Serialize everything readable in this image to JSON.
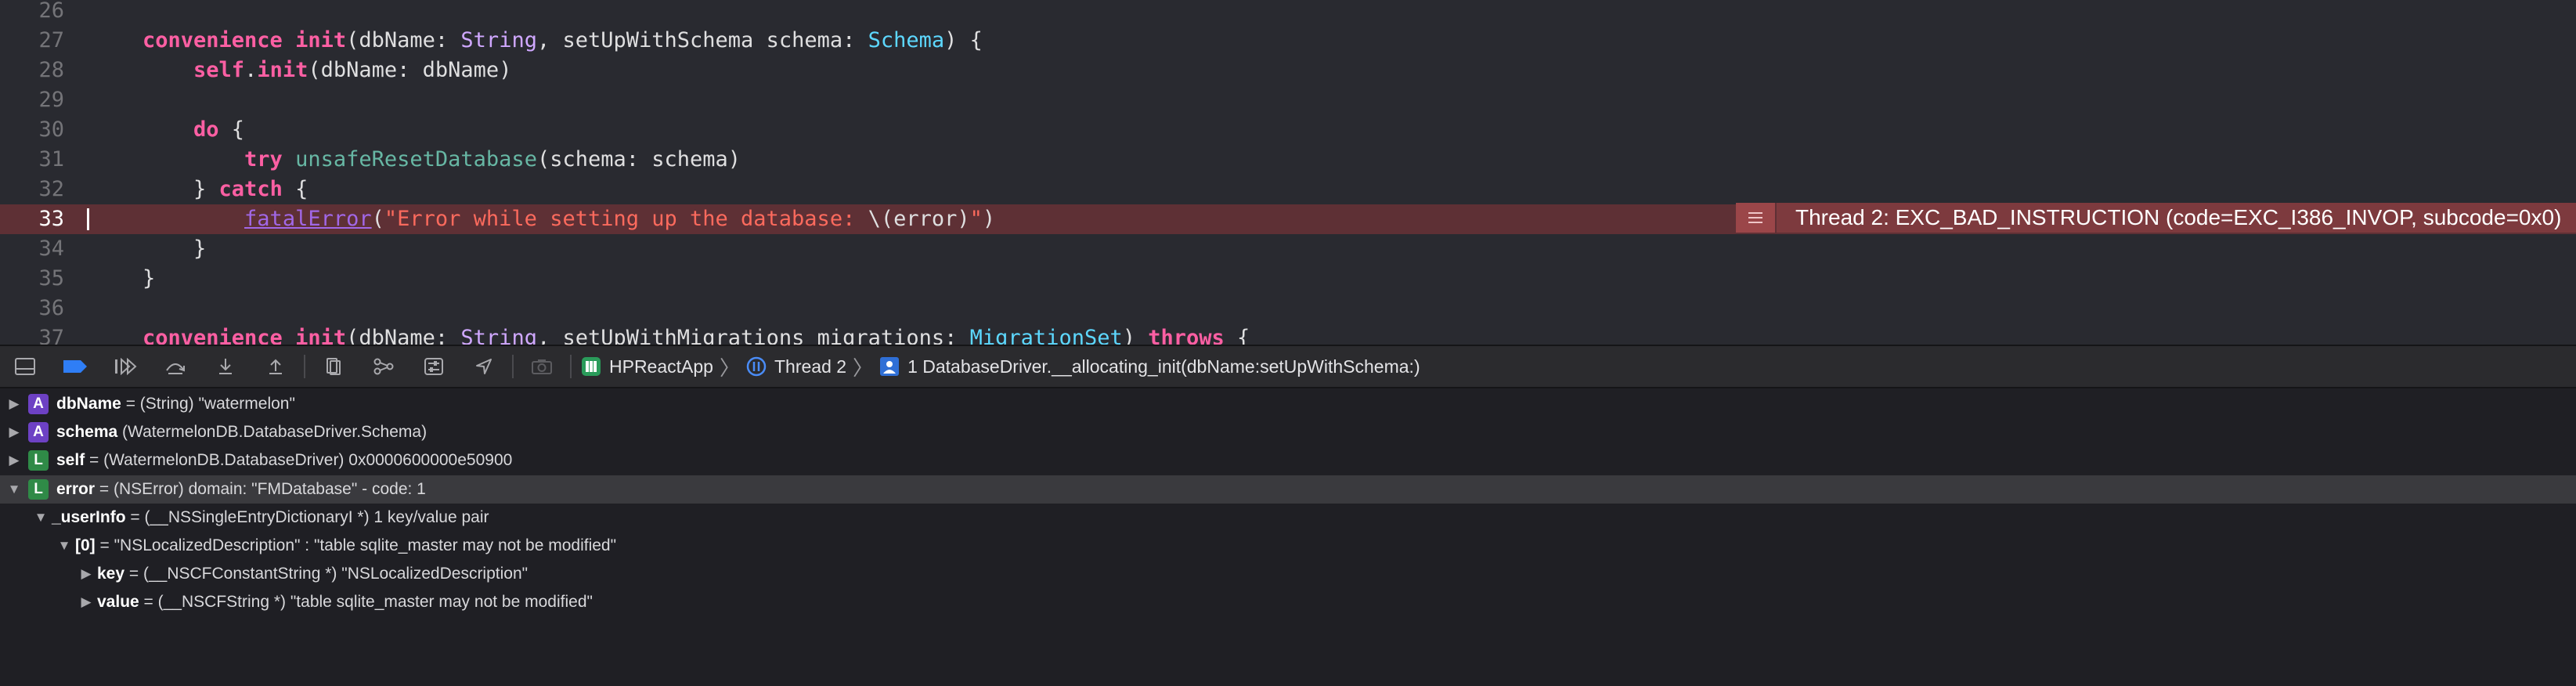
{
  "editor": {
    "lines": [
      {
        "num": "26",
        "parts": []
      },
      {
        "num": "27",
        "parts": [
          {
            "t": "kw",
            "v": "convenience"
          },
          {
            "t": "tx",
            "v": " "
          },
          {
            "t": "kw",
            "v": "init"
          },
          {
            "t": "tx",
            "v": "(dbName: "
          },
          {
            "t": "ty",
            "v": "String"
          },
          {
            "t": "tx",
            "v": ", setUpWithSchema schema: "
          },
          {
            "t": "tn",
            "v": "Schema"
          },
          {
            "t": "tx",
            "v": ") {"
          }
        ]
      },
      {
        "num": "28",
        "parts": [
          {
            "t": "tx",
            "v": "    "
          },
          {
            "t": "kw",
            "v": "self"
          },
          {
            "t": "tx",
            "v": "."
          },
          {
            "t": "kw",
            "v": "init"
          },
          {
            "t": "tx",
            "v": "(dbName: dbName)"
          }
        ]
      },
      {
        "num": "29",
        "parts": []
      },
      {
        "num": "30",
        "parts": [
          {
            "t": "tx",
            "v": "    "
          },
          {
            "t": "kw",
            "v": "do"
          },
          {
            "t": "tx",
            "v": " {"
          }
        ]
      },
      {
        "num": "31",
        "parts": [
          {
            "t": "tx",
            "v": "        "
          },
          {
            "t": "kw",
            "v": "try"
          },
          {
            "t": "tx",
            "v": " "
          },
          {
            "t": "fn",
            "v": "unsafeResetDatabase"
          },
          {
            "t": "tx",
            "v": "(schema: schema)"
          }
        ]
      },
      {
        "num": "32",
        "parts": [
          {
            "t": "tx",
            "v": "    } "
          },
          {
            "t": "kw",
            "v": "catch"
          },
          {
            "t": "tx",
            "v": " {"
          }
        ]
      },
      {
        "num": "33",
        "parts": [
          {
            "t": "tx",
            "v": "        "
          },
          {
            "t": "fe",
            "v": "fatalError"
          },
          {
            "t": "tx",
            "v": "("
          },
          {
            "t": "st",
            "v": "\"Error while setting up the database: "
          },
          {
            "t": "tx",
            "v": "\\(error)"
          },
          {
            "t": "st",
            "v": "\""
          },
          {
            "t": "tx",
            "v": ")"
          }
        ]
      },
      {
        "num": "34",
        "parts": [
          {
            "t": "tx",
            "v": "    }"
          }
        ]
      },
      {
        "num": "35",
        "parts": [
          {
            "t": "tx",
            "v": "}"
          }
        ]
      },
      {
        "num": "36",
        "parts": []
      },
      {
        "num": "37",
        "parts": [
          {
            "t": "kw",
            "v": "convenience"
          },
          {
            "t": "tx",
            "v": " "
          },
          {
            "t": "kw",
            "v": "init"
          },
          {
            "t": "tx",
            "v": "(dbName: "
          },
          {
            "t": "ty",
            "v": "String"
          },
          {
            "t": "tx",
            "v": ", setUpWithMigrations migrations: "
          },
          {
            "t": "tn",
            "v": "MigrationSet"
          },
          {
            "t": "tx",
            "v": ") "
          },
          {
            "t": "kw",
            "v": "throws"
          },
          {
            "t": "tx",
            "v": " {"
          }
        ]
      }
    ],
    "error_banner": "Thread 2: EXC_BAD_INSTRUCTION (code=EXC_I386_INVOP, subcode=0x0)"
  },
  "debug_bar": {
    "app": "HPReactApp",
    "thread": "Thread 2",
    "frame": "1 DatabaseDriver.__allocating_init(dbName:setUpWithSchema:)"
  },
  "variables": [
    {
      "indent": 0,
      "expanded": false,
      "badge": "A",
      "name": "dbName",
      "rest": " = (String) \"watermelon\""
    },
    {
      "indent": 0,
      "expanded": false,
      "badge": "A",
      "name": "schema",
      "rest": " (WatermelonDB.DatabaseDriver.Schema)"
    },
    {
      "indent": 0,
      "expanded": false,
      "badge": "L",
      "name": "self",
      "rest": " = (WatermelonDB.DatabaseDriver) 0x0000600000e50900"
    },
    {
      "indent": 0,
      "expanded": true,
      "badge": "L",
      "name": "error",
      "rest": " = (NSError) domain: \"FMDatabase\" - code: 1",
      "selected": true
    },
    {
      "indent": 1,
      "expanded": true,
      "badge": "",
      "name": "_userInfo",
      "rest": " = (__NSSingleEntryDictionaryI *) 1 key/value pair"
    },
    {
      "indent": 2,
      "expanded": true,
      "badge": "",
      "name": "[0]",
      "rest": " = \"NSLocalizedDescription\" : \"table sqlite_master may not be modified\""
    },
    {
      "indent": 3,
      "expanded": false,
      "badge": "",
      "name": "key",
      "rest": " = (__NSCFConstantString *) \"NSLocalizedDescription\""
    },
    {
      "indent": 3,
      "expanded": false,
      "badge": "",
      "name": "value",
      "rest": " = (__NSCFString *) \"table sqlite_master may not be modified\""
    }
  ]
}
